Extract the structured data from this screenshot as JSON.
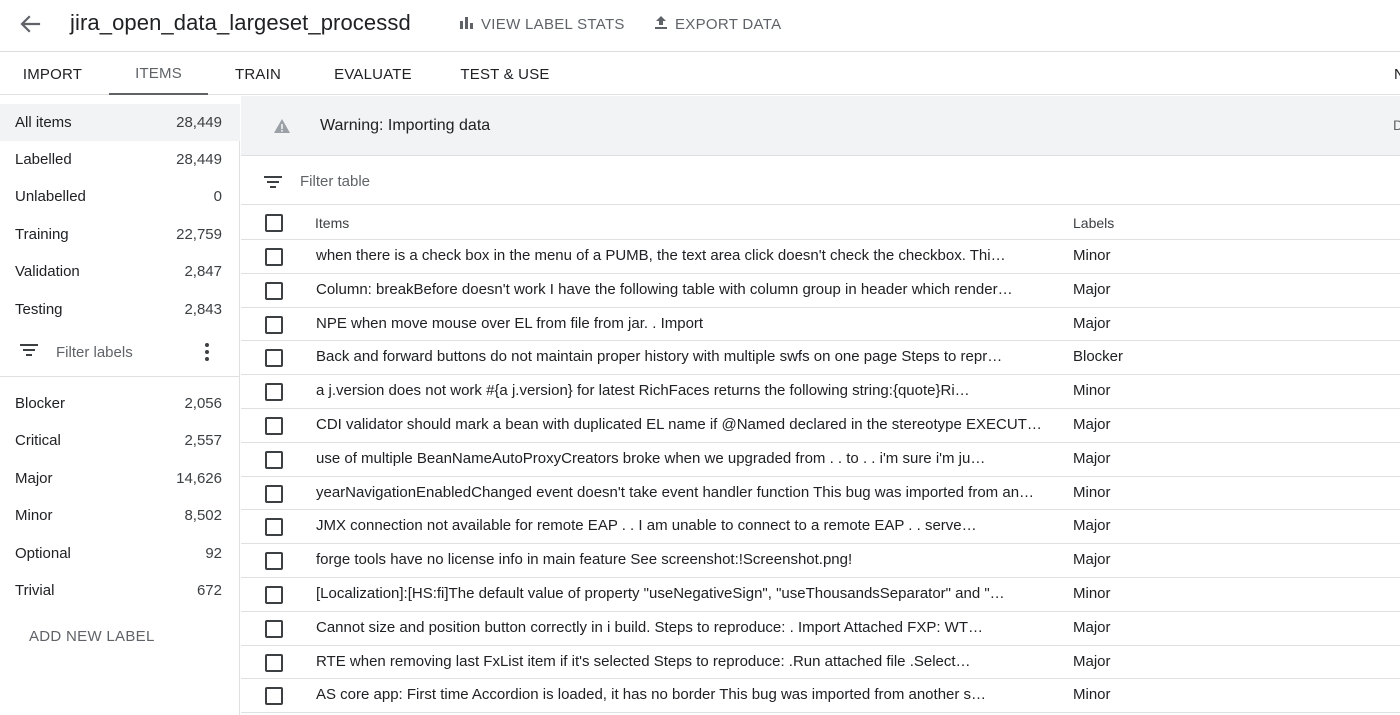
{
  "header": {
    "title": "jira_open_data_largeset_processd",
    "view_label_stats": "VIEW LABEL STATS",
    "export_data": "EXPORT DATA"
  },
  "tabs": [
    {
      "label": "IMPORT"
    },
    {
      "label": "ITEMS",
      "active": true
    },
    {
      "label": "TRAIN"
    },
    {
      "label": "EVALUATE"
    },
    {
      "label": "TEST & USE"
    }
  ],
  "tab_overflow": "N",
  "sidebar": {
    "splits": [
      {
        "label": "All items",
        "count": "28,449",
        "selected": true
      },
      {
        "label": "Labelled",
        "count": "28,449"
      },
      {
        "label": "Unlabelled",
        "count": "0"
      },
      {
        "label": "Training",
        "count": "22,759"
      },
      {
        "label": "Validation",
        "count": "2,847"
      },
      {
        "label": "Testing",
        "count": "2,843"
      }
    ],
    "filter_placeholder": "Filter labels",
    "labels": [
      {
        "label": "Blocker",
        "count": "2,056"
      },
      {
        "label": "Critical",
        "count": "2,557"
      },
      {
        "label": "Major",
        "count": "14,626"
      },
      {
        "label": "Minor",
        "count": "8,502"
      },
      {
        "label": "Optional",
        "count": "92"
      },
      {
        "label": "Trivial",
        "count": "672"
      }
    ],
    "add_label": "ADD NEW LABEL"
  },
  "warning": {
    "text": "Warning: Importing data",
    "trailing": "D"
  },
  "filter_table": "Filter table",
  "table": {
    "columns": {
      "items": "Items",
      "labels": "Labels"
    },
    "rows": [
      {
        "item": "when there is a check box in the menu of a PUMB, the text area click doesn't check the checkbox. Thi…",
        "label": "Minor"
      },
      {
        "item": "Column: breakBefore doesn't work I have the following table with column group in header which render…",
        "label": "Major"
      },
      {
        "item": "NPE when move mouse over EL from file from jar. . Import",
        "label": "Major"
      },
      {
        "item": "Back and forward buttons do not maintain proper history with multiple swfs on one page Steps to repr…",
        "label": "Blocker"
      },
      {
        "item": "a j.version does not work #{a j.version} for latest RichFaces returns the following string:{quote}Ri…",
        "label": "Minor"
      },
      {
        "item": "CDI validator should mark a bean with duplicated EL name if @Named declared in the stereotype EXECUT…",
        "label": "Major"
      },
      {
        "item": "use of multiple BeanNameAutoProxyCreators broke when we upgraded from . . to . . i'm sure i'm ju…",
        "label": "Major"
      },
      {
        "item": "yearNavigationEnabledChanged event doesn't take event handler function This bug was imported from an…",
        "label": "Minor"
      },
      {
        "item": "JMX connection not available for remote EAP . . I am unable to connect to a remote EAP . . serve…",
        "label": "Major"
      },
      {
        "item": "forge tools have no license info in main feature See screenshot:!Screenshot.png!",
        "label": "Major"
      },
      {
        "item": "[Localization]:[HS:fi]The default value of property \"useNegativeSign\", \"useThousandsSeparator\" and \"…",
        "label": "Minor"
      },
      {
        "item": "Cannot size and position button correctly in i build. Steps to reproduce: . Import Attached FXP: WT…",
        "label": "Major"
      },
      {
        "item": "RTE when removing last FxList item if it's selected Steps to reproduce: .Run attached file .Select…",
        "label": "Major"
      },
      {
        "item": "AS core app: First time Accordion is loaded, it has no border This bug was imported from another s…",
        "label": "Minor"
      }
    ]
  }
}
